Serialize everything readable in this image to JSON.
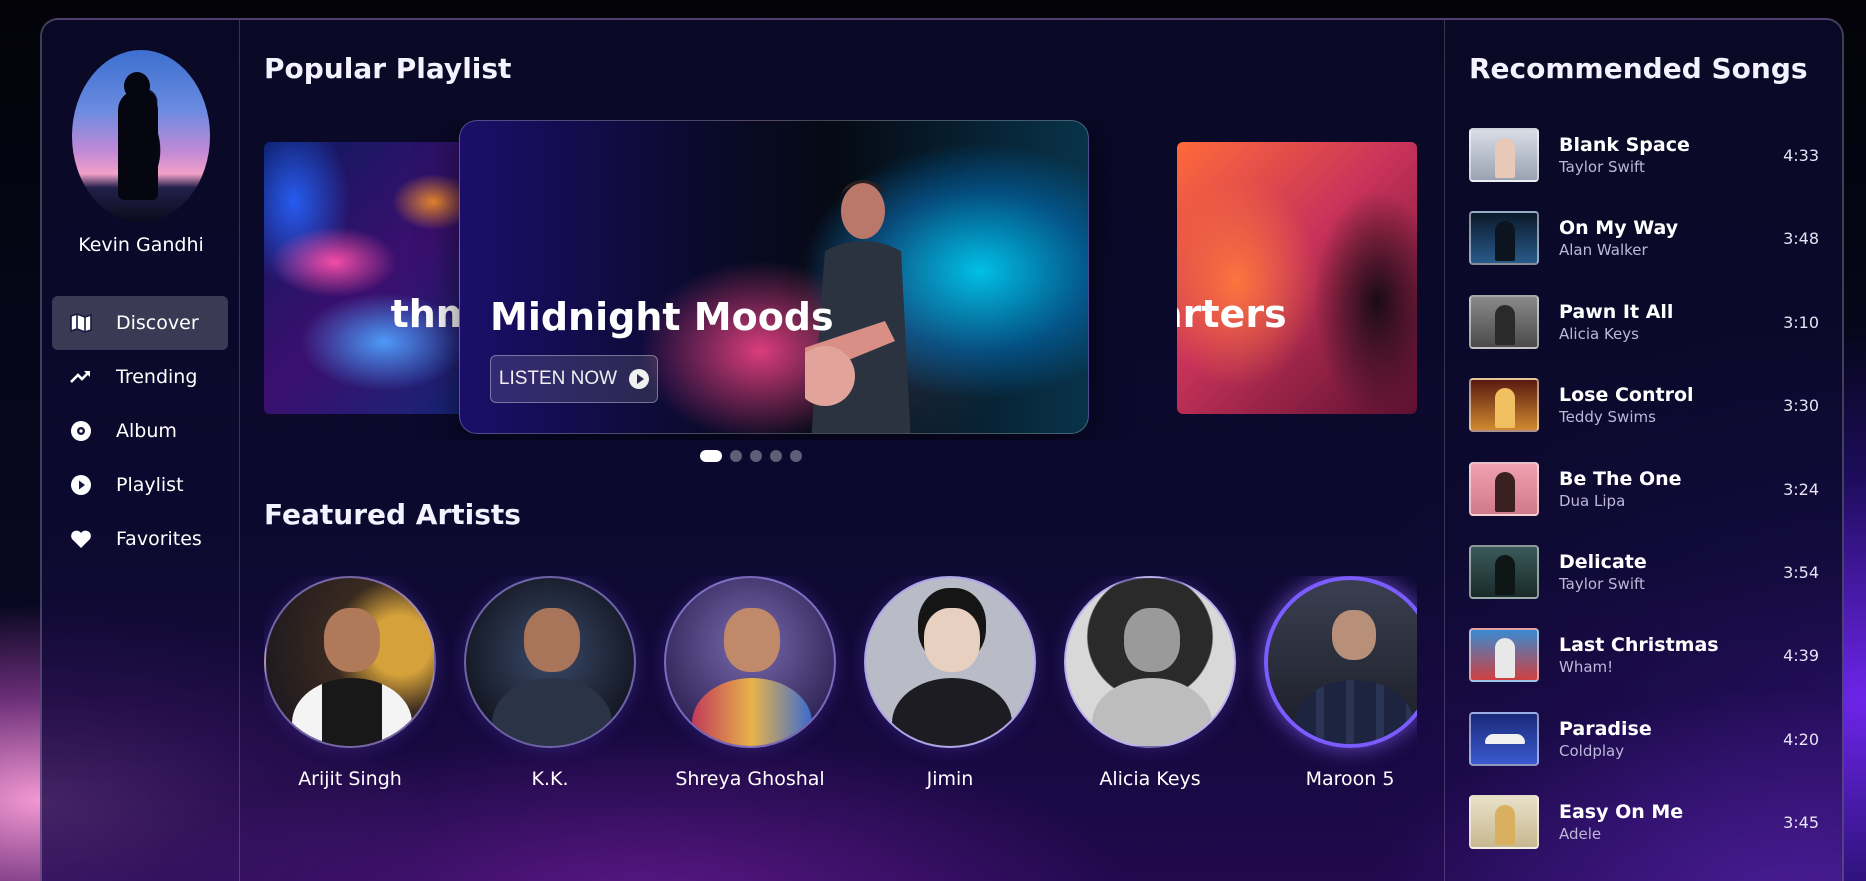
{
  "user": {
    "name": "Kevin Gandhi"
  },
  "nav": {
    "items": [
      {
        "label": "Discover",
        "icon": "map-icon",
        "active": true
      },
      {
        "label": "Trending",
        "icon": "trending-icon",
        "active": false
      },
      {
        "label": "Album",
        "icon": "disc-icon",
        "active": false
      },
      {
        "label": "Playlist",
        "icon": "play-circle-icon",
        "active": false
      },
      {
        "label": "Favorites",
        "icon": "heart-icon",
        "active": false
      }
    ]
  },
  "popular": {
    "heading": "Popular Playlist",
    "left_card_title": "thms",
    "center_card_title": "Midnight Moods",
    "right_card_title": "arters",
    "listen_button": "LISTEN NOW",
    "dots_count": 5,
    "active_dot": 0
  },
  "featured": {
    "heading": "Featured Artists",
    "artists": [
      {
        "name": "Arijit Singh"
      },
      {
        "name": "K.K."
      },
      {
        "name": "Shreya Ghoshal"
      },
      {
        "name": "Jimin"
      },
      {
        "name": "Alicia Keys"
      },
      {
        "name": "Maroon 5"
      }
    ]
  },
  "recommended": {
    "heading": "Recommended Songs",
    "songs": [
      {
        "title": "Blank Space",
        "artist": "Taylor Swift",
        "duration": "4:33"
      },
      {
        "title": "On My Way",
        "artist": "Alan Walker",
        "duration": "3:48"
      },
      {
        "title": "Pawn It All",
        "artist": "Alicia Keys",
        "duration": "3:10"
      },
      {
        "title": "Lose Control",
        "artist": "Teddy Swims",
        "duration": "3:30"
      },
      {
        "title": "Be The One",
        "artist": "Dua Lipa",
        "duration": "3:24"
      },
      {
        "title": "Delicate",
        "artist": "Taylor Swift",
        "duration": "3:54"
      },
      {
        "title": "Last Christmas",
        "artist": "Wham!",
        "duration": "4:39"
      },
      {
        "title": "Paradise",
        "artist": "Coldplay",
        "duration": "4:20"
      },
      {
        "title": "Easy On Me",
        "artist": "Adele",
        "duration": "3:45"
      }
    ]
  },
  "colors": {
    "accent": "#7a5cff",
    "nav_active_bg": "#ffffff33",
    "subtext": "#bdb8d8"
  }
}
